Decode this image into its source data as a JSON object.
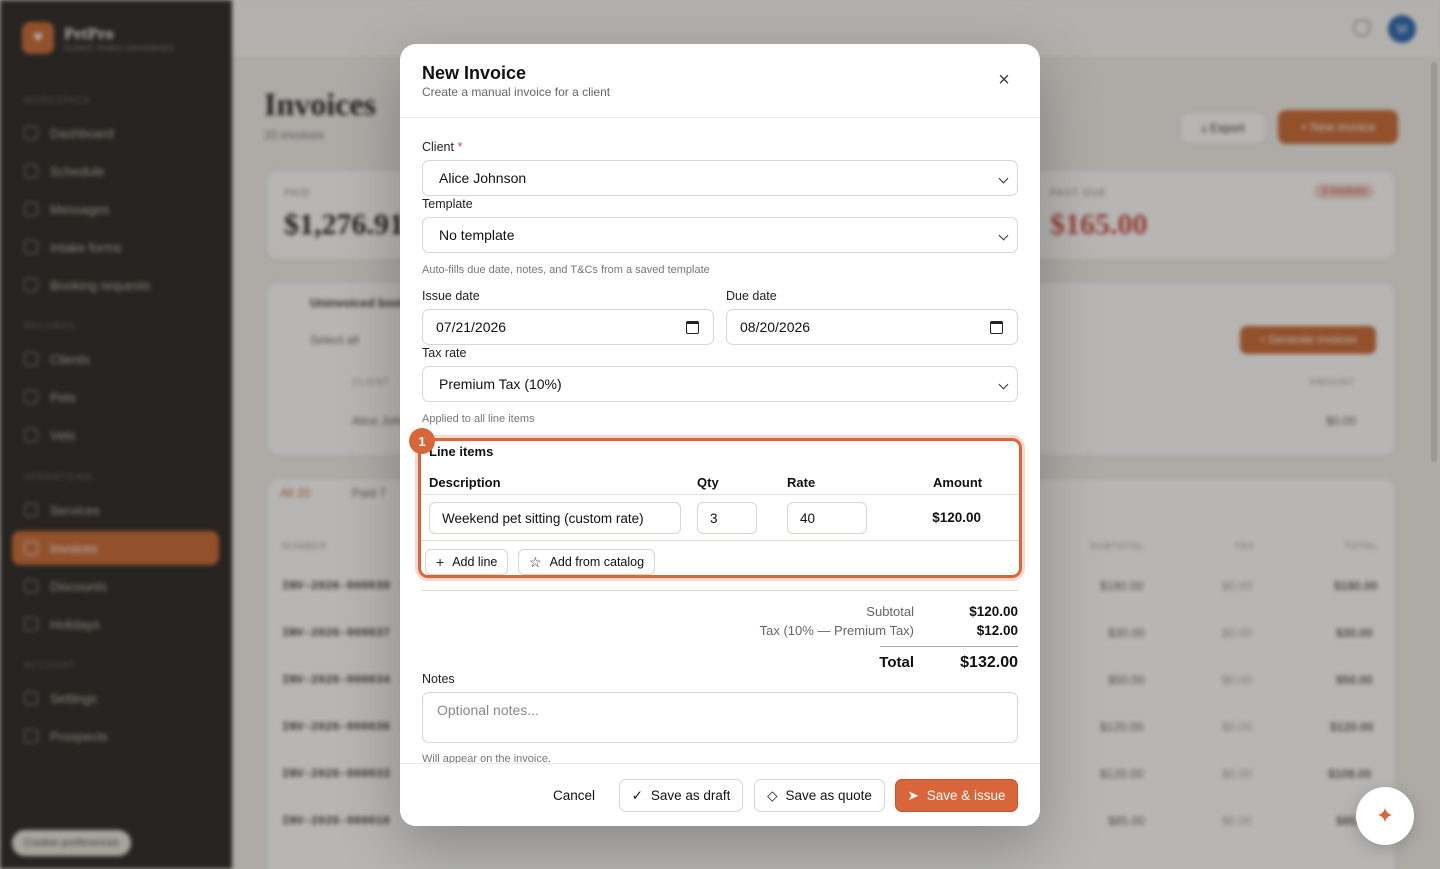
{
  "app": {
    "brand_name": "PetPro",
    "brand_sub": "SUNNY PAWS GROOMING",
    "user_initial": "M",
    "cookie_label": "Cookie preferences"
  },
  "sidebar": {
    "sections": [
      "WORKSPACE",
      "RECORDS",
      "OPERATIONS",
      "ACCOUNT"
    ],
    "items": [
      {
        "label": "Dashboard"
      },
      {
        "label": "Schedule"
      },
      {
        "label": "Messages"
      },
      {
        "label": "Intake forms"
      },
      {
        "label": "Booking requests"
      },
      {
        "label": "Clients"
      },
      {
        "label": "Pets"
      },
      {
        "label": "Vets"
      },
      {
        "label": "Services"
      },
      {
        "label": "Invoices"
      },
      {
        "label": "Discounts"
      },
      {
        "label": "Holidays"
      },
      {
        "label": "Settings"
      },
      {
        "label": "Prospects"
      }
    ]
  },
  "page": {
    "title": "Invoices",
    "subtitle": "20 invoices",
    "export_label": "Export",
    "new_invoice_label": "+ New invoice",
    "stats": {
      "paid_label": "PAID",
      "paid_value": "$1,276.91",
      "past_due_label": "PAST DUE",
      "past_due_value": "$165.00",
      "past_due_badge": "3 invoices"
    },
    "uninvoiced_title": "Uninvoiced bookings",
    "select_all": "Select all",
    "generate_label": "+ Generate invoices",
    "uninvoiced_col_client": "CLIENT",
    "uninvoiced_col_amount": "AMOUNT",
    "uninvoiced_row_client": "Alice Johnson",
    "uninvoiced_row_amount": "$0.00",
    "tabs": {
      "all": "All",
      "all_count": "20",
      "paid": "Paid",
      "paid_count": "7"
    },
    "cols": {
      "number": "NUMBER",
      "subtotal": "SUBTOTAL",
      "tax": "TAX",
      "total": "TOTAL"
    },
    "rows": [
      {
        "number": "INV-2026-000039",
        "subtotal": "$180.00",
        "tax": "$0.00",
        "total": "$180.00"
      },
      {
        "number": "INV-2026-000037",
        "subtotal": "$30.00",
        "tax": "$0.00",
        "total": "$30.00"
      },
      {
        "number": "INV-2026-000034",
        "subtotal": "$50.00",
        "tax": "$0.00",
        "total": "$50.00"
      },
      {
        "number": "INV-2026-000036",
        "subtotal": "$120.00",
        "tax": "$0.00",
        "total": "$120.00"
      },
      {
        "number": "INV-2026-000033",
        "subtotal": "$120.00",
        "tax": "$0.00",
        "total": "$108.00"
      },
      {
        "number": "INV-2026-000016",
        "subtotal": "$85.00",
        "tax": "$0.00",
        "total": "$85.00"
      }
    ]
  },
  "modal": {
    "title": "New Invoice",
    "subtitle": "Create a manual invoice for a client",
    "client_label": "Client",
    "required_mark": "*",
    "client_value": "Alice Johnson",
    "template_label": "Template",
    "template_value": "No template",
    "template_hint": "Auto-fills due date, notes, and T&Cs from a saved template",
    "issue_date_label": "Issue date",
    "issue_date_value": "07/21/2026",
    "due_date_label": "Due date",
    "due_date_value": "08/20/2026",
    "tax_rate_label": "Tax rate",
    "tax_rate_value": "Premium Tax (10%)",
    "tax_rate_hint": "Applied to all line items",
    "line_items": {
      "badge": "1",
      "title": "Line items",
      "col_description": "Description",
      "col_qty": "Qty",
      "col_rate": "Rate",
      "col_amount": "Amount",
      "rows": [
        {
          "description": "Weekend pet sitting (custom rate)",
          "qty": "3",
          "rate": "40",
          "amount": "$120.00"
        }
      ],
      "add_line_label": "Add line",
      "add_catalog_label": "Add from catalog"
    },
    "summary": {
      "subtotal_label": "Subtotal",
      "subtotal_value": "$120.00",
      "tax_label": "Tax (10% — Premium Tax)",
      "tax_value": "$12.00",
      "total_label": "Total",
      "total_value": "$132.00"
    },
    "notes_label": "Notes",
    "notes_placeholder": "Optional notes...",
    "notes_hint": "Will appear on the invoice.",
    "footer": {
      "cancel": "Cancel",
      "save_draft": "Save as draft",
      "save_quote": "Save as quote",
      "save_issue": "Save & issue"
    }
  },
  "colors": {
    "accent": "#d9653a",
    "sidebar_bg": "#2a2825"
  }
}
